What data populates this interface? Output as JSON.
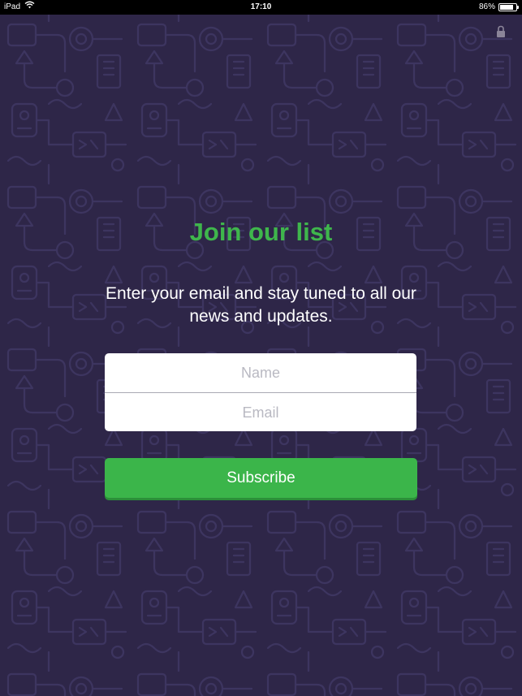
{
  "status_bar": {
    "device": "iPad",
    "time": "17:10",
    "battery_text": "86%",
    "battery_level": 0.86
  },
  "icons": {
    "wifi": "wifi-icon",
    "battery": "battery-icon",
    "lock": "lock-icon"
  },
  "colors": {
    "background": "#2e2648",
    "pattern_line": "#3d3560",
    "accent_green": "#3bb54a",
    "title_green": "#3fb64c",
    "text_white": "#ffffff",
    "placeholder": "#b9b9c2"
  },
  "signup": {
    "title": "Join our list",
    "subtitle": "Enter your email and stay tuned to all our news and updates.",
    "name_placeholder": "Name",
    "name_value": "",
    "email_placeholder": "Email",
    "email_value": "",
    "subscribe_label": "Subscribe"
  }
}
